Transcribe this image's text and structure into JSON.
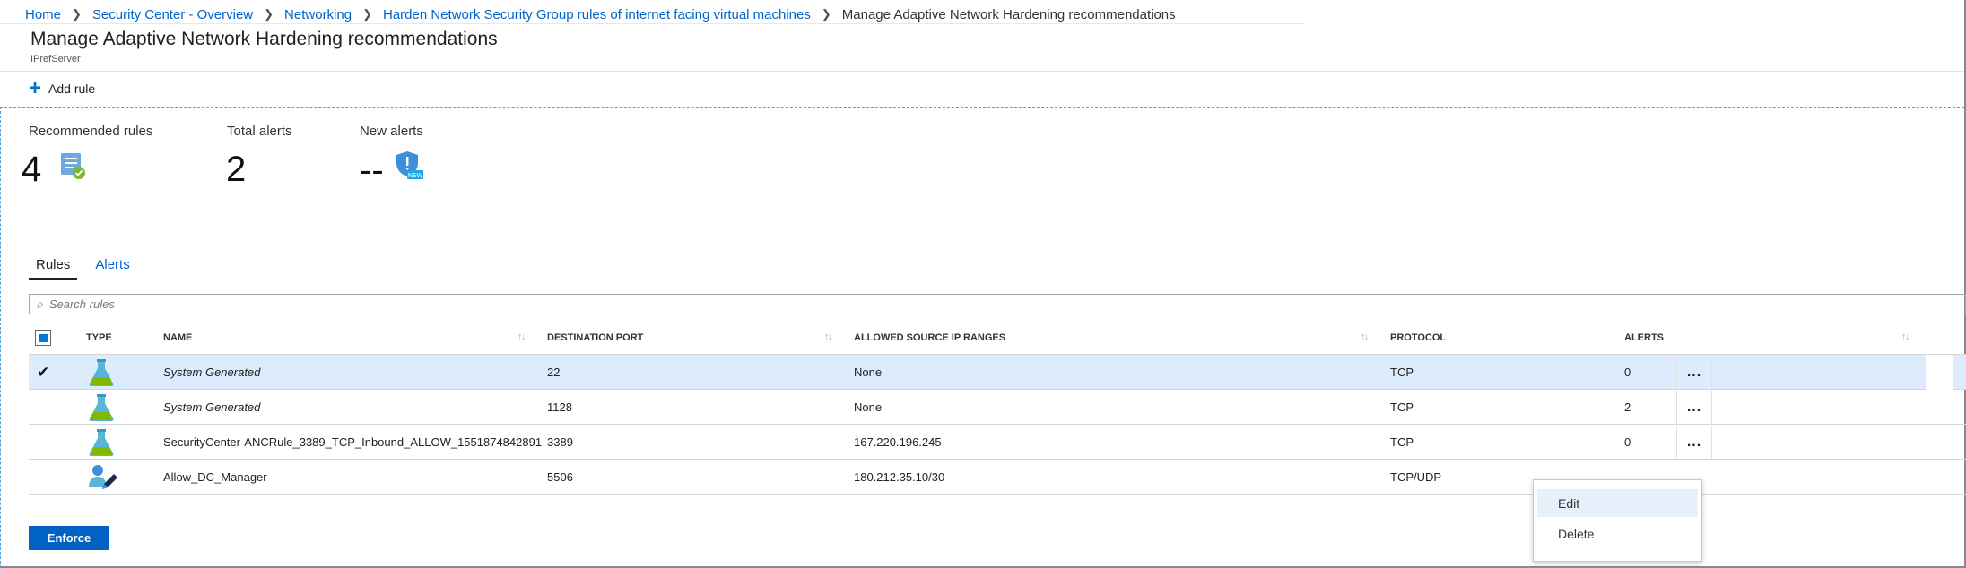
{
  "breadcrumb": {
    "items": [
      "Home",
      "Security Center - Overview",
      "Networking",
      "Harden Network Security Group rules of internet facing virtual machines"
    ],
    "current": "Manage Adaptive Network Hardening recommendations"
  },
  "page": {
    "title": "Manage Adaptive Network Hardening recommendations",
    "subtitle": "IPrefServer"
  },
  "toolbar": {
    "add_rule_label": "Add rule"
  },
  "stats": {
    "recommended_rules": {
      "label": "Recommended rules",
      "value": "4"
    },
    "total_alerts": {
      "label": "Total alerts",
      "value": "2"
    },
    "new_alerts": {
      "label": "New alerts",
      "value": "--"
    }
  },
  "tabs": [
    {
      "label": "Rules",
      "active": true
    },
    {
      "label": "Alerts",
      "active": false
    }
  ],
  "search": {
    "placeholder": "Search rules"
  },
  "table": {
    "columns": [
      "TYPE",
      "NAME",
      "DESTINATION PORT",
      "ALLOWED SOURCE IP RANGES",
      "PROTOCOL",
      "ALERTS"
    ],
    "rows": [
      {
        "type_icon": "flask-icon",
        "name": "System Generated",
        "port": "22",
        "ip_ranges": "None",
        "protocol": "TCP",
        "alerts": "0",
        "selected": true
      },
      {
        "type_icon": "flask-icon",
        "name": "System Generated",
        "port": "1128",
        "ip_ranges": "None",
        "protocol": "TCP",
        "alerts": "2",
        "selected": false
      },
      {
        "type_icon": "flask-icon",
        "name": "SecurityCenter-ANCRule_3389_TCP_Inbound_ALLOW_1551874842891",
        "port": "3389",
        "ip_ranges": "167.220.196.245",
        "protocol": "TCP",
        "alerts": "0",
        "selected": false
      },
      {
        "type_icon": "user-edit-icon",
        "name": "Allow_DC_Manager",
        "port": "5506",
        "ip_ranges": "180.212.35.10/30",
        "protocol": "TCP/UDP",
        "alerts": "",
        "selected": false
      }
    ],
    "row_menu_label": "..."
  },
  "context_menu": {
    "items": [
      "Edit",
      "Delete"
    ]
  },
  "footer": {
    "enforce_label": "Enforce"
  },
  "colors": {
    "accent": "#0064c8",
    "button": "#0062c4",
    "selected_row": "#dcecfc"
  }
}
